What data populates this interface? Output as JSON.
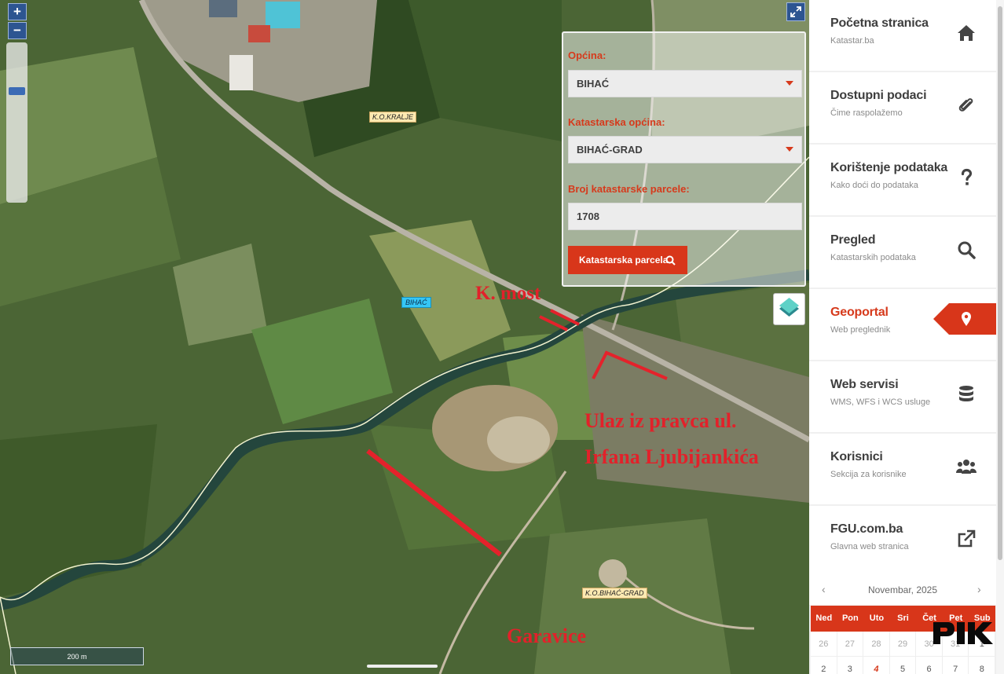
{
  "map": {
    "zoom_in": "+",
    "zoom_out": "−",
    "fullscreen_icon": "expand-icon",
    "labels": {
      "ko_kralje": "K.O.KRALJE",
      "bihac": "BIHAĆ",
      "ko_bihac_grad": "K.O.BIHAĆ-GRAD"
    },
    "annotations": {
      "most": "K. most",
      "ulaz_line1": "Ulaz iz pravca ul.",
      "ulaz_line2": "Irfana Ljubijankića",
      "garavice": "Garavice"
    },
    "annotation_color": "#e2212a",
    "scale": "200 m"
  },
  "search": {
    "opcina_label": "Općina:",
    "opcina_value": "BIHAĆ",
    "katastarska_label": "Katastarska općina:",
    "katastarska_value": "BIHAĆ-GRAD",
    "parcela_label": "Broj katastarske parcele:",
    "parcela_value": "1708",
    "button_label": "Katastarska parcela",
    "accent": "#d8361a"
  },
  "sidebar": {
    "items": [
      {
        "title": "Početna stranica",
        "sub": "Katastar.ba",
        "icon": "home-icon"
      },
      {
        "title": "Dostupni podaci",
        "sub": "Čime raspolažemo",
        "icon": "paperclip-icon"
      },
      {
        "title": "Korištenje podataka",
        "sub": "Kako doći do podataka",
        "icon": "question-icon"
      },
      {
        "title": "Pregled",
        "sub": "Katastarskih podataka",
        "icon": "search-icon"
      },
      {
        "title": "Geoportal",
        "sub": "Web preglednik",
        "icon": "map-marker-icon"
      },
      {
        "title": "Web servisi",
        "sub": "WMS, WFS i WCS usluge",
        "icon": "database-icon"
      },
      {
        "title": "Korisnici",
        "sub": "Sekcija za korisnike",
        "icon": "users-icon"
      },
      {
        "title": "FGU.com.ba",
        "sub": "Glavna web stranica",
        "icon": "external-link-icon"
      }
    ]
  },
  "calendar": {
    "prev": "‹",
    "next": "›",
    "title": "Novembar, 2025",
    "days": [
      "Ned",
      "Pon",
      "Uto",
      "Sri",
      "Čet",
      "Pet",
      "Sub"
    ],
    "row1": [
      "26",
      "27",
      "28",
      "29",
      "30",
      "31",
      "1"
    ],
    "row2": [
      "2",
      "3",
      "4",
      "5",
      "6",
      "7",
      "8"
    ]
  },
  "watermark": "PIK"
}
